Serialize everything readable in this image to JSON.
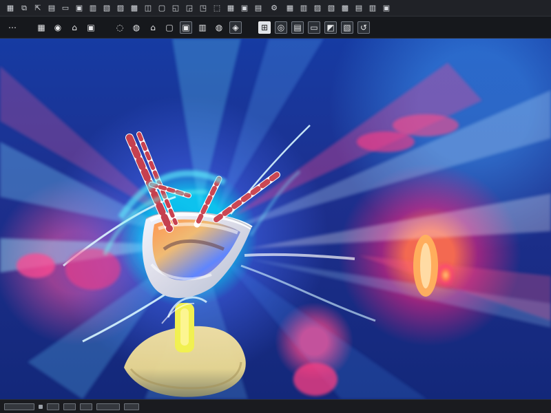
{
  "app": {
    "title": "",
    "background_color": "#1b1d22"
  },
  "toolbar_top": {
    "buttons": [
      {
        "name": "file-icon",
        "glyph": "▦"
      },
      {
        "name": "copy-icon",
        "glyph": "⧉"
      },
      {
        "name": "export-icon",
        "glyph": "⇱"
      },
      {
        "name": "grid-icon",
        "glyph": "▤"
      },
      {
        "name": "window-icon",
        "glyph": "▭"
      },
      {
        "name": "panel-icon",
        "glyph": "▣"
      },
      {
        "name": "display-icon",
        "glyph": "▥"
      },
      {
        "name": "layout-icon",
        "glyph": "▧"
      },
      {
        "name": "view-icon",
        "glyph": "▨"
      },
      {
        "name": "monitor-icon",
        "glyph": "▩"
      },
      {
        "name": "layers-icon",
        "glyph": "◫"
      },
      {
        "name": "camera-icon",
        "glyph": "▢"
      },
      {
        "name": "zoom-icon",
        "glyph": "◱"
      },
      {
        "name": "target-icon",
        "glyph": "◲"
      },
      {
        "name": "crop-icon",
        "glyph": "◳"
      },
      {
        "name": "transform-icon",
        "glyph": "⬚"
      },
      {
        "name": "image-icon",
        "glyph": "▦"
      },
      {
        "name": "frame-icon",
        "glyph": "▣"
      },
      {
        "name": "preview-icon",
        "glyph": "▤"
      },
      {
        "name": "settings-icon",
        "glyph": "⚙"
      },
      {
        "name": "window-toggle-icon",
        "glyph": "▦"
      },
      {
        "name": "table-icon",
        "glyph": "▥"
      },
      {
        "name": "canvas-icon",
        "glyph": "▨"
      },
      {
        "name": "overlay-icon",
        "glyph": "▧"
      },
      {
        "name": "panel-right-icon",
        "glyph": "▩"
      },
      {
        "name": "docs-icon",
        "glyph": "▤"
      },
      {
        "name": "tools-icon",
        "glyph": "▥"
      },
      {
        "name": "browser-icon",
        "glyph": "▣"
      }
    ]
  },
  "toolbar_second": {
    "buttons": [
      {
        "name": "menu-icon",
        "glyph": "⋯"
      },
      {
        "name": "image-icon",
        "glyph": "▦"
      },
      {
        "name": "brush-icon",
        "glyph": "◉"
      },
      {
        "name": "eraser-icon",
        "glyph": "⌂"
      },
      {
        "name": "layers-icon",
        "glyph": "▣"
      },
      {
        "name": "palette-icon",
        "glyph": "◌"
      },
      {
        "name": "bucket-icon",
        "glyph": "◍"
      },
      {
        "name": "lock-icon",
        "glyph": "⌂"
      },
      {
        "name": "card-icon",
        "glyph": "▢"
      },
      {
        "name": "shape-icon",
        "glyph": "▣"
      },
      {
        "name": "mask-icon",
        "glyph": "▥"
      },
      {
        "name": "adjust-icon",
        "glyph": "◍"
      },
      {
        "name": "stamp-icon",
        "glyph": "◈"
      },
      {
        "name": "filter-icon",
        "glyph": "⊞"
      },
      {
        "name": "circle-select-icon",
        "glyph": "◎"
      },
      {
        "name": "text-icon",
        "glyph": "▤"
      },
      {
        "name": "rect-select-icon",
        "glyph": "▭"
      },
      {
        "name": "crop-icon",
        "glyph": "◩"
      },
      {
        "name": "transform-icon",
        "glyph": "▧"
      },
      {
        "name": "history-icon",
        "glyph": "↺"
      }
    ]
  },
  "status": {
    "left_label": "",
    "right_label": ""
  },
  "colors": {
    "toolbar": "#202227",
    "toolbar_secondary": "#16181c",
    "canvas_blue": "#163ba3",
    "cyan_glow": "#0ad8ff",
    "pink_glow": "#ff2f7f",
    "orange_glow": "#ff8a4a"
  }
}
